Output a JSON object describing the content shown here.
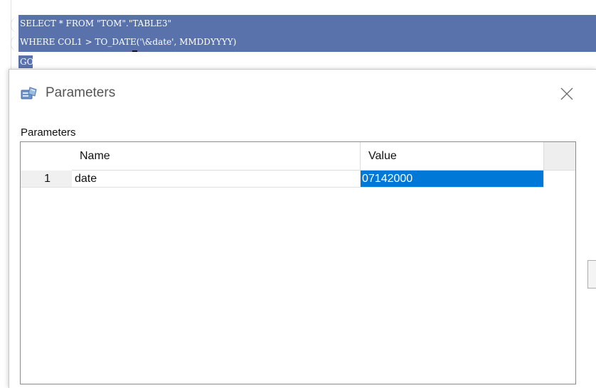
{
  "editor": {
    "lines": [
      "SELECT * FROM \"TOM\".\"TABLE3\"",
      "WHERE COL1 > TO_DATE('\\&date', MMDDYYYY)",
      "GO"
    ]
  },
  "dialog": {
    "title": "Parameters",
    "icon": "parameters-icon",
    "close_icon": "close-icon",
    "group_label": "Parameters",
    "grid": {
      "columns": [
        "Name",
        "Value"
      ],
      "rows": [
        {
          "num": "1",
          "name": "date",
          "value": "07142000"
        }
      ]
    }
  },
  "colors": {
    "selection": "#5a72ac",
    "cell_edit": "#0078d7"
  }
}
